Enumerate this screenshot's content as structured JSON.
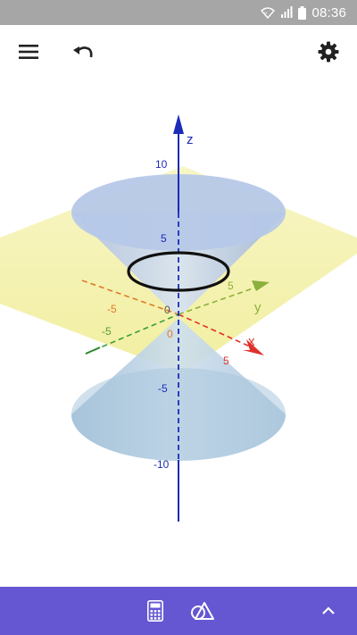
{
  "status_bar": {
    "time": "08:36",
    "icons": [
      "wifi-icon",
      "signal-icon",
      "battery-icon"
    ]
  },
  "toolbar": {
    "icons": [
      "menu-icon",
      "undo-icon",
      "settings-icon"
    ]
  },
  "graph": {
    "axis_labels": {
      "x": "x",
      "y": "y",
      "z": "z"
    },
    "z_ticks": [
      "10",
      "5",
      "-5",
      "-10"
    ],
    "origin_labels": [
      "0",
      "0"
    ],
    "x_ticks": [
      "5",
      "-5"
    ],
    "y_ticks": [
      "5",
      "-5"
    ],
    "axis_colors": {
      "x": "#e0302a",
      "y": "#8cb03c",
      "z": "#1c2bb8"
    },
    "surfaces": [
      "double-cone",
      "plane",
      "intersection-circle"
    ]
  },
  "bottom_bar": {
    "icons": [
      "calculator-icon",
      "tools-icon",
      "chevron-up-icon"
    ],
    "background": "#6557d2"
  }
}
